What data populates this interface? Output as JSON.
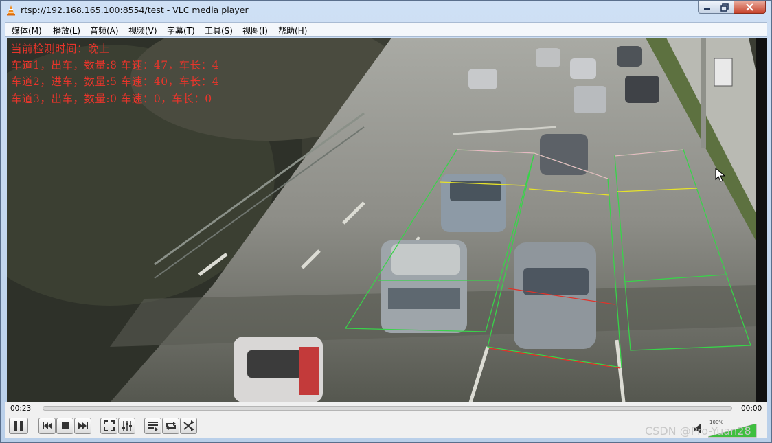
{
  "window": {
    "title": "rtsp://192.168.165.100:8554/test - VLC media player"
  },
  "menu": [
    {
      "label": "媒体(M)"
    },
    {
      "label": "播放(L)"
    },
    {
      "label": "音频(A)"
    },
    {
      "label": "视频(V)"
    },
    {
      "label": "字幕(T)"
    },
    {
      "label": "工具(S)"
    },
    {
      "label": "视图(I)"
    },
    {
      "label": "帮助(H)"
    }
  ],
  "overlay": {
    "line1": "当前检测时间：晚上",
    "line2": "车道1，出车，数量:8  车速：47，车长：4",
    "line3": "车道2，进车，数量:5  车速：40，车长：4",
    "line4": "车道3，出车，数量:0  车速：0，车长：0"
  },
  "playback": {
    "elapsed": "00:23",
    "total": "00:00",
    "volume_label": "100%",
    "volume_level": 1.0
  },
  "watermark": "CSDN @Pro-Yuan28",
  "colors": {
    "overlay_text": "#e8352b",
    "zone_green": "#39d34a",
    "zone_yellow": "#e6e22a",
    "zone_red": "#e0332a",
    "zone_pink": "#e7b7c4"
  }
}
